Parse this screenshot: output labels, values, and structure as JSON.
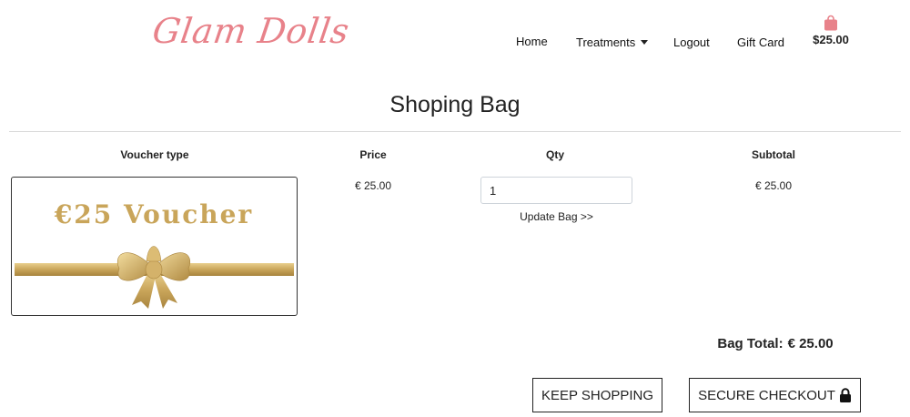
{
  "brand": {
    "logo_text": "Glam Dolls",
    "accent_color": "#e8828a"
  },
  "nav": {
    "home": "Home",
    "treatments": "Treatments",
    "logout": "Logout",
    "gift_card": "Gift Card",
    "bag_icon": "shopping-bag-icon",
    "bag_total": "$25.00"
  },
  "page": {
    "title": "Shoping Bag"
  },
  "table": {
    "headers": {
      "type": "Voucher type",
      "price": "Price",
      "qty": "Qty",
      "subtotal": "Subtotal"
    },
    "items": [
      {
        "image_text": "€25 Voucher",
        "price": "€ 25.00",
        "qty": "1",
        "update_label": "Update Bag >>",
        "subtotal": "€ 25.00"
      }
    ]
  },
  "summary": {
    "label": "Bag Total:",
    "value": "€ 25.00"
  },
  "actions": {
    "keep_shopping": "Keep Shopping",
    "secure_checkout": "Secure Checkout",
    "checkout_icon": "lock-icon"
  },
  "colors": {
    "voucher_gold": "#c9a55a",
    "text": "#222222"
  }
}
